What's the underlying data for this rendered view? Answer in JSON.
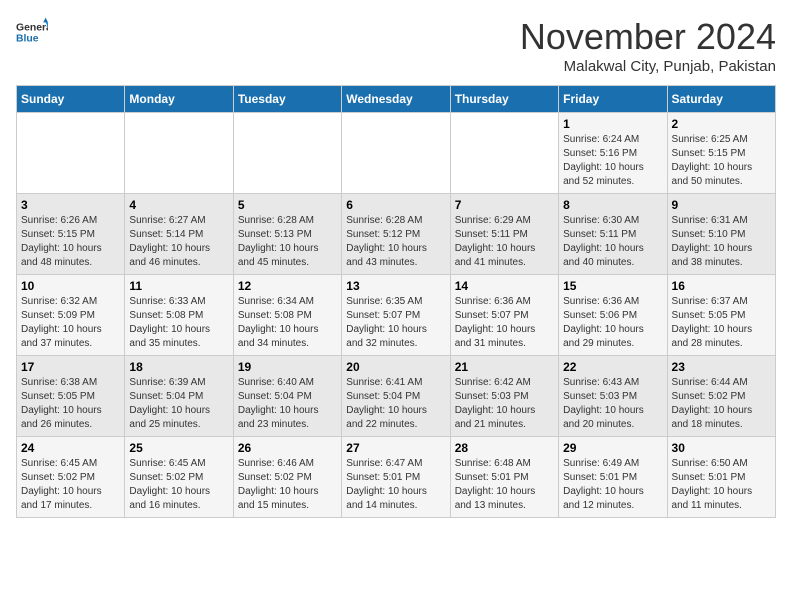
{
  "header": {
    "logo_general": "General",
    "logo_blue": "Blue",
    "month_title": "November 2024",
    "location": "Malakwal City, Punjab, Pakistan"
  },
  "days_of_week": [
    "Sunday",
    "Monday",
    "Tuesday",
    "Wednesday",
    "Thursday",
    "Friday",
    "Saturday"
  ],
  "weeks": [
    [
      {
        "day": "",
        "info": ""
      },
      {
        "day": "",
        "info": ""
      },
      {
        "day": "",
        "info": ""
      },
      {
        "day": "",
        "info": ""
      },
      {
        "day": "",
        "info": ""
      },
      {
        "day": "1",
        "info": "Sunrise: 6:24 AM\nSunset: 5:16 PM\nDaylight: 10 hours\nand 52 minutes."
      },
      {
        "day": "2",
        "info": "Sunrise: 6:25 AM\nSunset: 5:15 PM\nDaylight: 10 hours\nand 50 minutes."
      }
    ],
    [
      {
        "day": "3",
        "info": "Sunrise: 6:26 AM\nSunset: 5:15 PM\nDaylight: 10 hours\nand 48 minutes."
      },
      {
        "day": "4",
        "info": "Sunrise: 6:27 AM\nSunset: 5:14 PM\nDaylight: 10 hours\nand 46 minutes."
      },
      {
        "day": "5",
        "info": "Sunrise: 6:28 AM\nSunset: 5:13 PM\nDaylight: 10 hours\nand 45 minutes."
      },
      {
        "day": "6",
        "info": "Sunrise: 6:28 AM\nSunset: 5:12 PM\nDaylight: 10 hours\nand 43 minutes."
      },
      {
        "day": "7",
        "info": "Sunrise: 6:29 AM\nSunset: 5:11 PM\nDaylight: 10 hours\nand 41 minutes."
      },
      {
        "day": "8",
        "info": "Sunrise: 6:30 AM\nSunset: 5:11 PM\nDaylight: 10 hours\nand 40 minutes."
      },
      {
        "day": "9",
        "info": "Sunrise: 6:31 AM\nSunset: 5:10 PM\nDaylight: 10 hours\nand 38 minutes."
      }
    ],
    [
      {
        "day": "10",
        "info": "Sunrise: 6:32 AM\nSunset: 5:09 PM\nDaylight: 10 hours\nand 37 minutes."
      },
      {
        "day": "11",
        "info": "Sunrise: 6:33 AM\nSunset: 5:08 PM\nDaylight: 10 hours\nand 35 minutes."
      },
      {
        "day": "12",
        "info": "Sunrise: 6:34 AM\nSunset: 5:08 PM\nDaylight: 10 hours\nand 34 minutes."
      },
      {
        "day": "13",
        "info": "Sunrise: 6:35 AM\nSunset: 5:07 PM\nDaylight: 10 hours\nand 32 minutes."
      },
      {
        "day": "14",
        "info": "Sunrise: 6:36 AM\nSunset: 5:07 PM\nDaylight: 10 hours\nand 31 minutes."
      },
      {
        "day": "15",
        "info": "Sunrise: 6:36 AM\nSunset: 5:06 PM\nDaylight: 10 hours\nand 29 minutes."
      },
      {
        "day": "16",
        "info": "Sunrise: 6:37 AM\nSunset: 5:05 PM\nDaylight: 10 hours\nand 28 minutes."
      }
    ],
    [
      {
        "day": "17",
        "info": "Sunrise: 6:38 AM\nSunset: 5:05 PM\nDaylight: 10 hours\nand 26 minutes."
      },
      {
        "day": "18",
        "info": "Sunrise: 6:39 AM\nSunset: 5:04 PM\nDaylight: 10 hours\nand 25 minutes."
      },
      {
        "day": "19",
        "info": "Sunrise: 6:40 AM\nSunset: 5:04 PM\nDaylight: 10 hours\nand 23 minutes."
      },
      {
        "day": "20",
        "info": "Sunrise: 6:41 AM\nSunset: 5:04 PM\nDaylight: 10 hours\nand 22 minutes."
      },
      {
        "day": "21",
        "info": "Sunrise: 6:42 AM\nSunset: 5:03 PM\nDaylight: 10 hours\nand 21 minutes."
      },
      {
        "day": "22",
        "info": "Sunrise: 6:43 AM\nSunset: 5:03 PM\nDaylight: 10 hours\nand 20 minutes."
      },
      {
        "day": "23",
        "info": "Sunrise: 6:44 AM\nSunset: 5:02 PM\nDaylight: 10 hours\nand 18 minutes."
      }
    ],
    [
      {
        "day": "24",
        "info": "Sunrise: 6:45 AM\nSunset: 5:02 PM\nDaylight: 10 hours\nand 17 minutes."
      },
      {
        "day": "25",
        "info": "Sunrise: 6:45 AM\nSunset: 5:02 PM\nDaylight: 10 hours\nand 16 minutes."
      },
      {
        "day": "26",
        "info": "Sunrise: 6:46 AM\nSunset: 5:02 PM\nDaylight: 10 hours\nand 15 minutes."
      },
      {
        "day": "27",
        "info": "Sunrise: 6:47 AM\nSunset: 5:01 PM\nDaylight: 10 hours\nand 14 minutes."
      },
      {
        "day": "28",
        "info": "Sunrise: 6:48 AM\nSunset: 5:01 PM\nDaylight: 10 hours\nand 13 minutes."
      },
      {
        "day": "29",
        "info": "Sunrise: 6:49 AM\nSunset: 5:01 PM\nDaylight: 10 hours\nand 12 minutes."
      },
      {
        "day": "30",
        "info": "Sunrise: 6:50 AM\nSunset: 5:01 PM\nDaylight: 10 hours\nand 11 minutes."
      }
    ]
  ]
}
